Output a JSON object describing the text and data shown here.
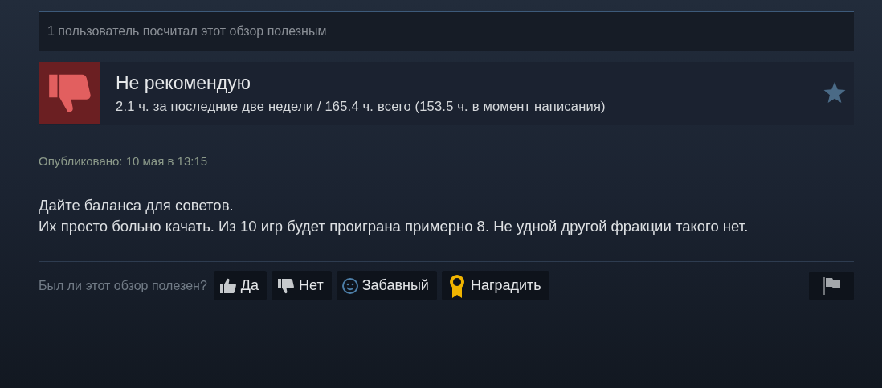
{
  "helpful_count": "1 пользователь посчитал этот обзор полезным",
  "review": {
    "recommended": false,
    "title": "Не рекомендую",
    "hours": "2.1 ч. за последние две недели / 165.4 ч. всего (153.5 ч. в момент написания)"
  },
  "posted": "Опубликовано: 10 мая в 13:15",
  "body": [
    "Дайте баланса для советов.",
    "Их просто больно качать. Из 10 игр будет проиграна примерно 8. Не удной другой фракции такого нет."
  ],
  "vote_prompt": "Был ли этот обзор полезен?",
  "buttons": [
    {
      "kind": "yes",
      "label": "Да"
    },
    {
      "kind": "no",
      "label": "Нет"
    },
    {
      "kind": "funny",
      "label": "Забавный"
    },
    {
      "kind": "award",
      "label": "Наградить"
    }
  ]
}
